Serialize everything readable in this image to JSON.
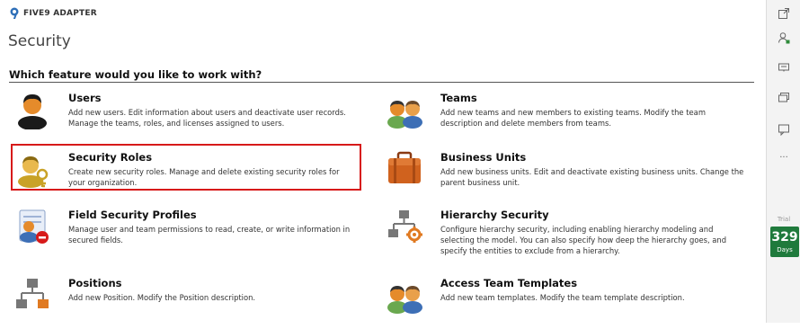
{
  "app": {
    "name": "FIVE9 ADAPTER"
  },
  "page": {
    "title": "Security",
    "question": "Which feature would you like to work with?"
  },
  "features": [
    {
      "name": "Users",
      "icon": "user-icon",
      "description": "Add new users. Edit information about users and deactivate user records. Manage the teams, roles, and licenses assigned to users."
    },
    {
      "name": "Teams",
      "icon": "teams-icon",
      "description": "Add new teams and new members to existing teams. Modify the team description and delete members from teams."
    },
    {
      "name": "Security Roles",
      "icon": "security-roles-icon",
      "selected": true,
      "description": "Create new security roles. Manage and delete existing security roles for your organization."
    },
    {
      "name": "Business Units",
      "icon": "briefcase-icon",
      "description": "Add new business units. Edit and deactivate existing business units. Change the parent business unit."
    },
    {
      "name": "Field Security Profiles",
      "icon": "field-security-icon",
      "description": "Manage user and team permissions to read, create, or write information in secured fields."
    },
    {
      "name": "Hierarchy Security",
      "icon": "hierarchy-icon",
      "description": "Configure hierarchy security, including enabling hierarchy modeling and selecting the model. You can also specify how deep the hierarchy goes, and specify the entities to exclude from a hierarchy."
    },
    {
      "name": "Positions",
      "icon": "positions-icon",
      "description": "Add new Position. Modify the Position description."
    },
    {
      "name": "Access Team Templates",
      "icon": "access-team-icon",
      "description": "Add new team templates. Modify the team template description."
    }
  ],
  "rail": {
    "icons": [
      "expand-icon",
      "user-status-icon",
      "chat-icon",
      "messages-icon",
      "comment-icon",
      "more-icon"
    ],
    "more_label": "···",
    "trial_label": "Trial",
    "trial_days": "329",
    "days_label": "Days"
  },
  "colors": {
    "accent_red": "#d71a1a",
    "trial_green": "#1f7a3c"
  }
}
